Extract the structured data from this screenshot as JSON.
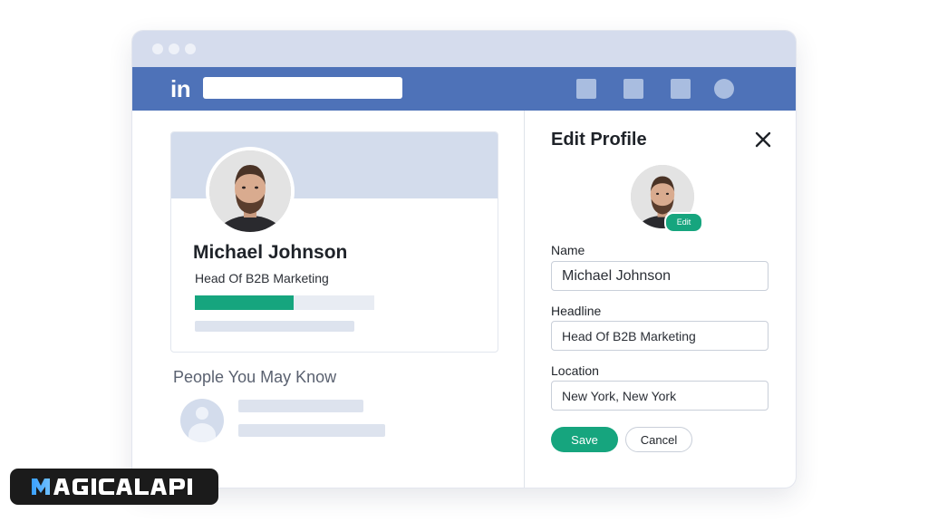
{
  "navbar": {
    "logo": "in",
    "search_value": "",
    "icons": [
      "home-icon",
      "network-icon",
      "messaging-icon",
      "profile-icon"
    ]
  },
  "profile_card": {
    "name": "Michael Johnson",
    "headline": "Head Of B2B Marketing",
    "progress_percent": 55
  },
  "people_you_may_know": {
    "title": "People You May Know"
  },
  "edit_profile": {
    "title": "Edit Profile",
    "edit_badge": "Edit",
    "fields": {
      "name": {
        "label": "Name",
        "value": "Michael Johnson"
      },
      "headline": {
        "label": "Headline",
        "value": "Head Of B2B Marketing"
      },
      "location": {
        "label": "Location",
        "value": "New York, New York"
      }
    },
    "save_label": "Save",
    "cancel_label": "Cancel"
  },
  "watermark": {
    "text": "MAGICALAPI"
  },
  "colors": {
    "nav_blue": "#4e72b8",
    "accent_green": "#16a57e",
    "banner": "#d3dcec"
  }
}
